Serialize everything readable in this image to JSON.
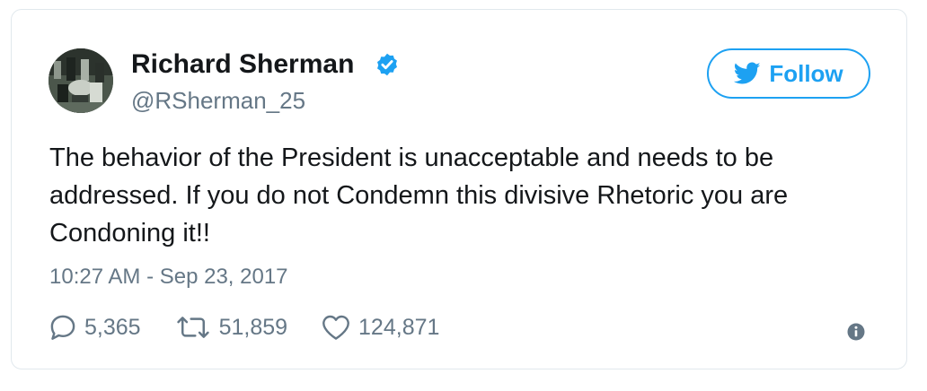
{
  "tweet": {
    "author_name": "Richard Sherman",
    "handle": "@RSherman_25",
    "follow_label": "Follow",
    "text": "The behavior of the President is unacceptable and needs to be addressed. If you do not Condemn this divisive Rhetoric you are Condoning it!!",
    "timestamp": "10:27 AM - Sep 23, 2017",
    "replies": "5,365",
    "retweets": "51,859",
    "likes": "124,871"
  },
  "colors": {
    "brand_blue": "#1da1f2",
    "text_primary": "#14171a",
    "text_secondary": "#657786",
    "border": "#e1e8ed"
  },
  "icons": {
    "verified": "verified-badge-icon",
    "follow": "twitter-bird-icon",
    "reply": "reply-bubble-icon",
    "retweet": "retweet-arrows-icon",
    "like": "heart-icon",
    "info": "info-circle-icon"
  }
}
